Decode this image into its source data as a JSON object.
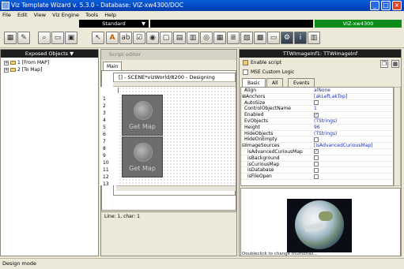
{
  "window": {
    "title": "Viz Template Wizard v. 5.3.0 - Database: VIZ-xw4300/DOC"
  },
  "menu": [
    "File",
    "Edit",
    "View",
    "Viz Engine",
    "Tools",
    "Help"
  ],
  "toolbar": {
    "mode": "Standard",
    "engine": "VIZ-xw4300"
  },
  "left_panel": {
    "title": "Exposed Objects",
    "items": [
      {
        "expander": "+",
        "label": "1 [From MAP]"
      },
      {
        "expander": "+",
        "label": "2 [To Map]"
      }
    ]
  },
  "script_editor": {
    "title": "Script editor",
    "tab": "Main",
    "designer_title": "[] - SCENE*vizWorld/8200 - Designing",
    "line_numbers": [
      "1",
      "2",
      "3",
      "4",
      "5",
      "6",
      "7",
      "8",
      "9",
      "10",
      "11",
      "12",
      "13"
    ],
    "buttons": [
      "Get Map",
      "Get Map"
    ],
    "status": "Line: 1, char: 1"
  },
  "right_panel": {
    "title": "TTWImageInf1: TTWImageInf",
    "enable_script": "Enable script",
    "mse_logic": "MSE Custom Logic",
    "tabs": [
      "Basic",
      "All",
      "Events"
    ],
    "properties": [
      {
        "expander": "",
        "name": "Align",
        "value": "alNone",
        "check": ""
      },
      {
        "expander": "⊞",
        "name": "Anchors",
        "value": "[akLeft,akTop]",
        "check": ""
      },
      {
        "expander": "",
        "name": "AutoSize",
        "value": "",
        "check": "off"
      },
      {
        "expander": "",
        "name": "ControlObjectName",
        "value": "1",
        "check": ""
      },
      {
        "expander": "",
        "name": "Enabled",
        "value": "",
        "check": "on"
      },
      {
        "expander": "",
        "name": "EvObjects",
        "value": "(TStrings)",
        "check": ""
      },
      {
        "expander": "",
        "name": "Height",
        "value": "96",
        "check": ""
      },
      {
        "expander": "",
        "name": "HideObjects",
        "value": "(TStrings)",
        "check": ""
      },
      {
        "expander": "",
        "name": "HideOnEmpty",
        "value": "",
        "check": "off"
      },
      {
        "expander": "⊟",
        "name": "ImageSources",
        "value": "[isAdvancedCuriousMap]",
        "check": ""
      },
      {
        "expander": "",
        "name": "isAdvancedCuriousMap",
        "value": "",
        "check": "on"
      },
      {
        "expander": "",
        "name": "isBackground",
        "value": "",
        "check": "off"
      },
      {
        "expander": "",
        "name": "isCuriousMap",
        "value": "",
        "check": "off"
      },
      {
        "expander": "",
        "name": "isDatabase",
        "value": "",
        "check": "off"
      },
      {
        "expander": "",
        "name": "isFileOpen",
        "value": "",
        "check": "off"
      }
    ],
    "preview_hint": "Doubleclick to change thumbnail..."
  },
  "statusbar": {
    "text": "Design mode"
  },
  "icons": [
    "app-icon",
    "minimize-icon",
    "maximize-icon",
    "close-icon",
    "pointer-icon",
    "text-icon",
    "image-icon",
    "grid-icon",
    "info-icon",
    "settings-icon",
    "folder-icon",
    "globe-icon"
  ]
}
